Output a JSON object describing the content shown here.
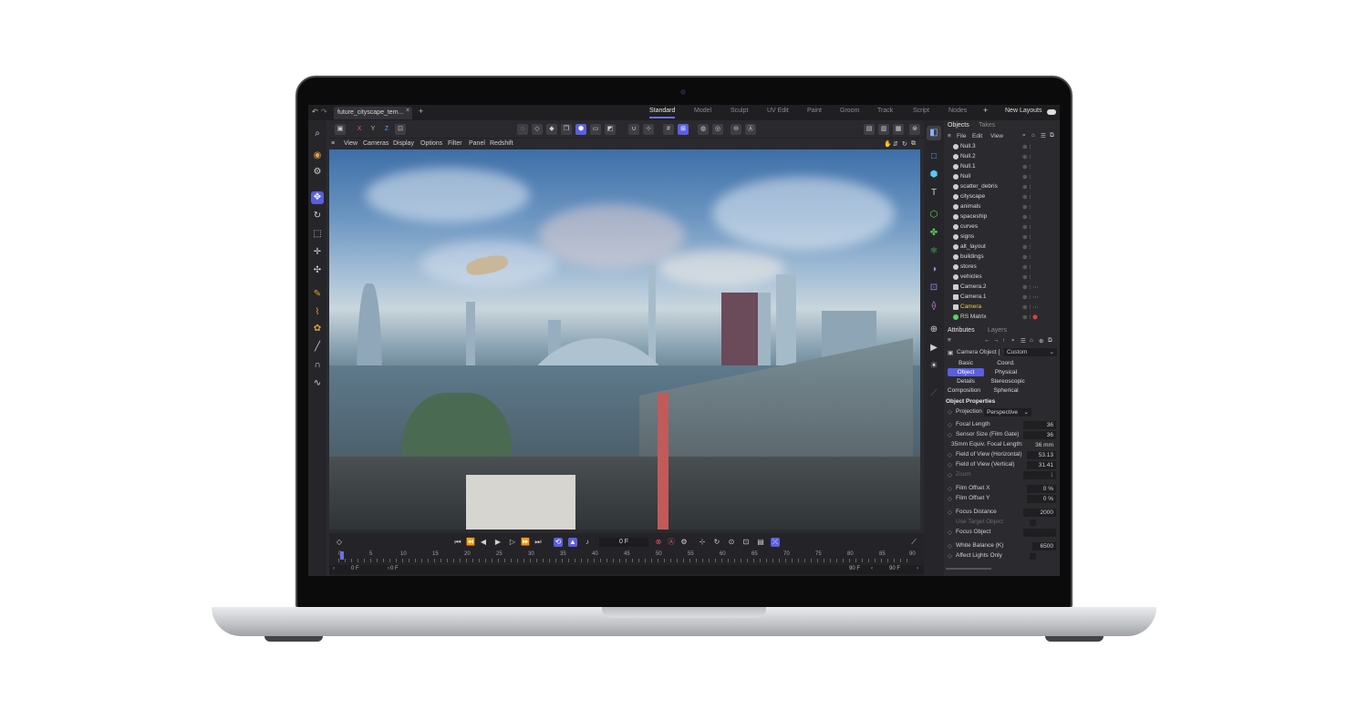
{
  "titlebar": {
    "document_tab": "future_cityscape_tem...",
    "layouts": [
      "Standard",
      "Model",
      "Sculpt",
      "UV Edit",
      "Paint",
      "Groom",
      "Track",
      "Script",
      "Nodes"
    ],
    "active_layout": "Standard",
    "new_layouts": "New Layouts"
  },
  "toolbar": {
    "axes": [
      "X",
      "Y",
      "Z"
    ]
  },
  "viewport_menu": [
    "View",
    "Cameras",
    "Display",
    "Options",
    "Filter",
    "Panel",
    "Redshift"
  ],
  "timeline": {
    "current_frame": "0 F",
    "ticks": [
      "0",
      "5",
      "10",
      "15",
      "20",
      "25",
      "30",
      "35",
      "40",
      "45",
      "50",
      "55",
      "60",
      "65",
      "70",
      "75",
      "80",
      "85",
      "90"
    ],
    "start_frame": "0 F",
    "min_frame": "0 F",
    "max_frame": "90 F",
    "end_frame": "90 F"
  },
  "objects_panel": {
    "tabs": [
      "Objects",
      "Takes"
    ],
    "menu": [
      "File",
      "Edit",
      "View"
    ],
    "items": [
      "Null.3",
      "Null.2",
      "Null.1",
      "Null",
      "scatter_debris",
      "cityscape",
      "animals",
      "spaceship",
      "curves",
      "signs",
      "alt_layout",
      "buildings",
      "stores",
      "vehicles",
      "Camera.2",
      "Camera.1",
      "Camera",
      "RS Matrix"
    ],
    "selected": "Camera"
  },
  "attributes_panel": {
    "tabs": [
      "Attributes",
      "Layers"
    ],
    "object_label": "Camera Object [",
    "mode_select": "Custom",
    "groups": [
      "Basic",
      "Coord.",
      "Object",
      "Physical",
      "Details",
      "Stereoscopic",
      "Composition",
      "Spherical"
    ],
    "active_group": "Object",
    "section_title": "Object Properties",
    "projection_label": "Projection",
    "projection_value": "Perspective",
    "properties": [
      {
        "label": "Focal Length",
        "value": "36"
      },
      {
        "label": "Sensor Size (Film Gate)",
        "value": "36"
      },
      {
        "label": "35mm Equiv. Focal Length:",
        "value": "36 mm"
      },
      {
        "label": "Field of View (Horizontal)",
        "value": "53.13"
      },
      {
        "label": "Field of View (Vertical)",
        "value": "31.41"
      },
      {
        "label": "Zoom",
        "value": "1"
      },
      {
        "label": "Film Offset X",
        "value": "0 %"
      },
      {
        "label": "Film Offset Y",
        "value": "0 %"
      },
      {
        "label": "Focus Distance",
        "value": "2000"
      },
      {
        "label": "Use Target Object",
        "value": ""
      },
      {
        "label": "Focus Object",
        "value": ""
      },
      {
        "label": "White Balance (K)",
        "value": "6500"
      },
      {
        "label": "Affect Lights Only",
        "value": ""
      }
    ]
  }
}
